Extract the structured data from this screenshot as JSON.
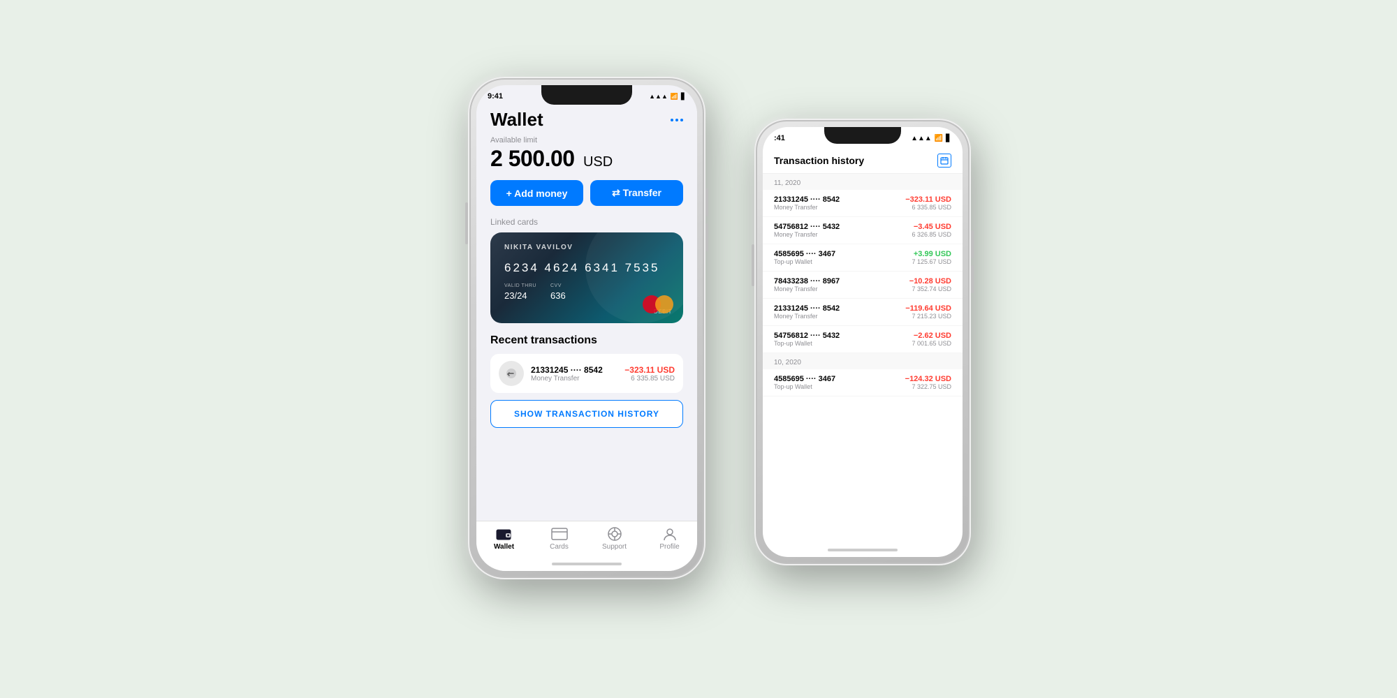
{
  "background_color": "#dde8dd",
  "front_phone": {
    "status_bar": {
      "time": "9:41",
      "signal": "●●●",
      "wifi": "wifi",
      "battery": "battery"
    },
    "header": {
      "title": "Wallet",
      "menu_dots": "···"
    },
    "balance": {
      "label": "Available limit",
      "amount": "2 500.00",
      "currency": "USD"
    },
    "buttons": {
      "add_money": "+ Add money",
      "transfer": "⇄ Transfer"
    },
    "linked_cards": {
      "label": "Linked cards",
      "card": {
        "holder": "NIKITA VAVILOV",
        "number": "6234  4624  6341  7535",
        "valid_thru_label": "VALID THRU",
        "valid_thru": "23/24",
        "cvv_label": "CVV",
        "cvv": "636",
        "type_label": "DEBIT"
      }
    },
    "recent_transactions": {
      "title": "Recent transactions",
      "items": [
        {
          "card": "21331245 ···· 8542",
          "type": "Money Transfer",
          "amount": "−323.11 USD",
          "balance": "6 335.85 USD"
        }
      ],
      "show_button": "SHOW TRANSACTION HISTORY"
    },
    "tab_bar": {
      "items": [
        {
          "label": "Wallet",
          "active": true
        },
        {
          "label": "Cards",
          "active": false
        },
        {
          "label": "Support",
          "active": false
        },
        {
          "label": "Profile",
          "active": false
        }
      ]
    }
  },
  "back_phone": {
    "status_bar": {
      "time": ":41",
      "signal": "●●●",
      "wifi": "wifi",
      "battery": "battery"
    },
    "header": {
      "title": "Transaction history"
    },
    "date_groups": [
      {
        "date": "11, 2020",
        "items": [
          {
            "card": "21331245 ···· 8542",
            "type": "Money Transfer",
            "amount": "−323.11 USD",
            "balance": "6 335.85 USD",
            "positive": false
          },
          {
            "card": "54756812 ···· 5432",
            "type": "Money Transfer",
            "amount": "−3.45 USD",
            "balance": "6 326.85 USD",
            "positive": false
          },
          {
            "card": "4585695 ···· 3467",
            "type": "Top-up Wallet",
            "amount": "+3.99 USD",
            "balance": "7 125.67 USD",
            "positive": true
          },
          {
            "card": "78433238 ···· 8967",
            "type": "Money Transfer",
            "amount": "−10.28 USD",
            "balance": "7 352.74 USD",
            "positive": false
          },
          {
            "card": "21331245 ···· 8542",
            "type": "Money Transfer",
            "amount": "−119.64 USD",
            "balance": "7 215.23 USD",
            "positive": false
          },
          {
            "card": "54756812 ···· 5432",
            "type": "Top-up Wallet",
            "amount": "−2.62 USD",
            "balance": "7 001.65 USD",
            "positive": false
          }
        ]
      },
      {
        "date": "10, 2020",
        "items": [
          {
            "card": "4585695 ···· 3467",
            "type": "Top-up Wallet",
            "amount": "−124.32 USD",
            "balance": "7 322.75 USD",
            "positive": false
          }
        ]
      }
    ]
  }
}
